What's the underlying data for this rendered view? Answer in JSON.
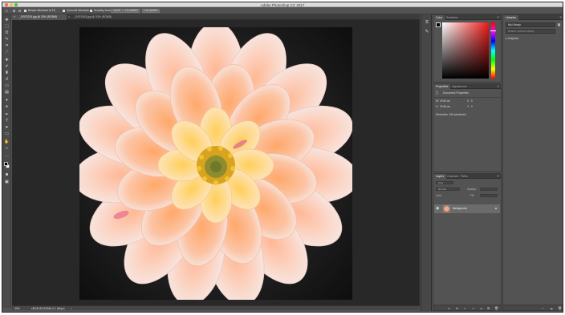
{
  "window": {
    "title": "Adobe Photoshop CC 2017"
  },
  "options_bar": {
    "resize_windows_label": "Resize Windows to Fit",
    "zoom_all_windows_label": "Zoom All Windows",
    "scrubby_zoom_label": "Scrubby Zoom",
    "btn_100": "100%",
    "btn_fit": "Fit Screen",
    "btn_fill": "Fill Screen"
  },
  "tabs": [
    {
      "label": "_DSF2224.jpg @ 33% (RGB/8)",
      "active": true
    },
    {
      "label": "_DSF1553.jpg @ 33% (RGB/8)",
      "active": false
    }
  ],
  "status": {
    "zoom": "33%",
    "doc_profile": "sRGB IEC61966-2.1 (8bpc)"
  },
  "color_panel": {
    "tabs": [
      "Color",
      "Swatches"
    ],
    "colors": {
      "hue_top": "#ff0000",
      "spectrum_right": "#f01a1a"
    }
  },
  "properties_panel": {
    "tabs": [
      "Properties",
      "Adjustments"
    ],
    "title": "Document Properties",
    "w_label": "W:",
    "w_value": "29.68 cm",
    "h_label": "H:",
    "h_value": "29.68 cm",
    "x_label": "X:",
    "x_value": "0",
    "y_label": "Y:",
    "y_value": "0",
    "resolution": "Resolution: 240 pixels/inch"
  },
  "layers_panel": {
    "tabs": [
      "Layers",
      "Channels",
      "Paths"
    ],
    "kind_label": "Kind",
    "normal_label": "Normal",
    "opacity_label": "Opacity:",
    "lock_label": "Lock:",
    "fill_label": "Fill:",
    "layers": [
      {
        "name": "Background",
        "visible": true,
        "locked": true
      }
    ]
  },
  "libraries_panel": {
    "tab": "Libraries",
    "library_name": "My Library",
    "search_placeholder": "Search Current Library",
    "section": "Graphics"
  },
  "tools": [
    "move-icon",
    "marquee-icon",
    "lasso-icon",
    "quick-select-icon",
    "crop-icon",
    "eyedropper-icon",
    "healing-icon",
    "brush-icon",
    "clone-stamp-icon",
    "history-brush-icon",
    "eraser-icon",
    "gradient-icon",
    "blur-icon",
    "dodge-icon",
    "pen-icon",
    "type-icon",
    "path-select-icon",
    "rectangle-icon",
    "hand-icon",
    "zoom-icon"
  ]
}
